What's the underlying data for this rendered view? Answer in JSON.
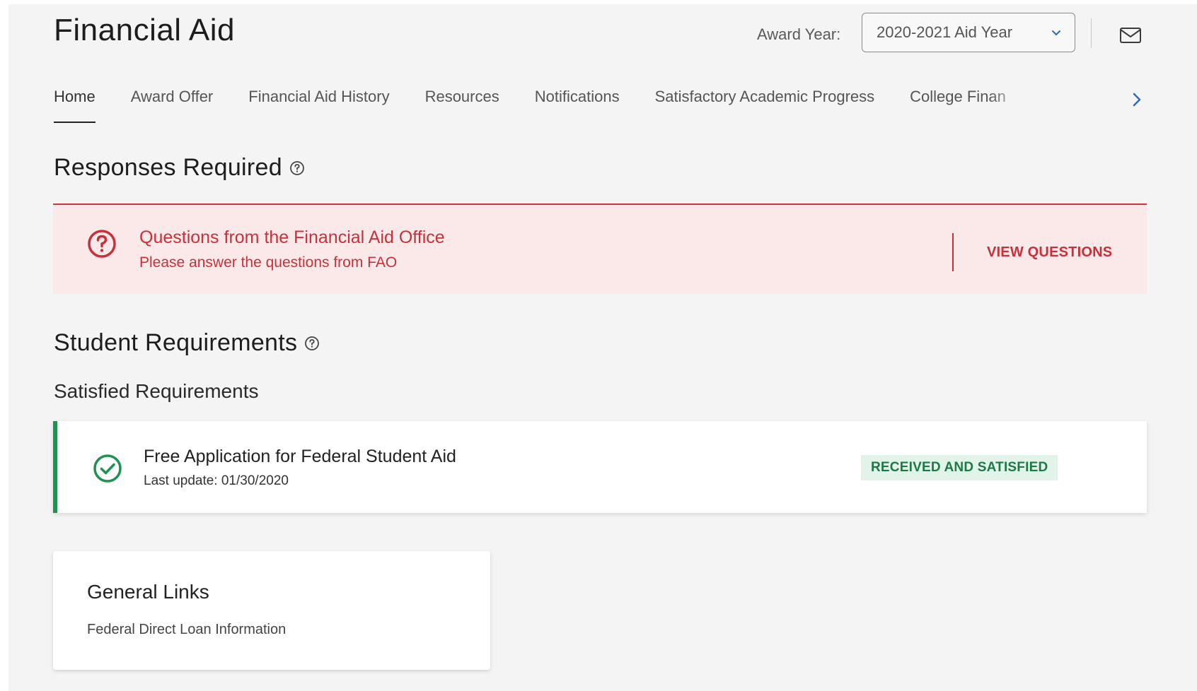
{
  "header": {
    "title": "Financial Aid",
    "award_year_label": "Award Year:",
    "award_year_value": "2020-2021 Aid Year",
    "mail_icon": "mail-icon"
  },
  "nav": {
    "tabs": [
      {
        "label": "Home",
        "active": true
      },
      {
        "label": "Award Offer"
      },
      {
        "label": "Financial Aid History"
      },
      {
        "label": "Resources"
      },
      {
        "label": "Notifications"
      },
      {
        "label": "Satisfactory Academic Progress"
      },
      {
        "label": "College Finan"
      }
    ],
    "next_icon": "chevron-right-icon"
  },
  "responses": {
    "heading": "Responses Required",
    "alert": {
      "title": "Questions from the Financial Aid Office",
      "subtitle": "Please answer the questions from FAO",
      "action": "VIEW QUESTIONS",
      "icon": "question-circle-icon",
      "color": "#c8303a"
    }
  },
  "student_requirements": {
    "heading": "Student Requirements",
    "subheading": "Satisfied Requirements",
    "items": [
      {
        "title": "Free Application for Federal Student Aid",
        "updated": "Last update: 01/30/2020",
        "status": "RECEIVED AND SATISFIED",
        "icon": "check-circle-icon",
        "color": "#1f9150"
      }
    ]
  },
  "general_links": {
    "heading": "General Links",
    "items": [
      "Federal Direct Loan Information"
    ]
  }
}
